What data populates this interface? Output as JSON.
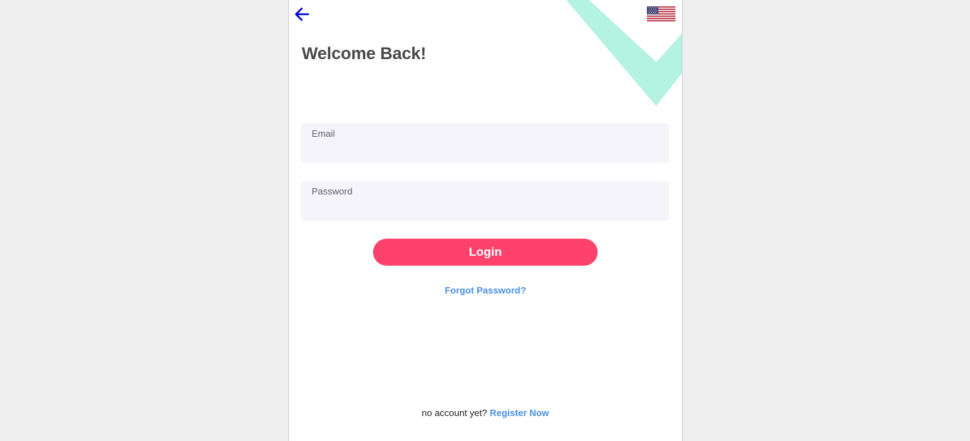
{
  "colors": {
    "page_background": "#eeeeee",
    "panel_background": "#ffffff",
    "accent_decoration": "#b4f2e1",
    "back_arrow": "#0000dd",
    "title_text": "#4a4a4a",
    "field_background": "#f6f4fb",
    "login_button": "#fd436b",
    "link": "#4a90e2"
  },
  "header": {
    "back_icon": "arrow-left-icon",
    "language_icon": "us-flag-icon"
  },
  "title": "Welcome Back!",
  "form": {
    "email": {
      "label": "Email",
      "value": ""
    },
    "password": {
      "label": "Password",
      "value": ""
    },
    "login_label": "Login",
    "forgot_password": "Forgot Password?"
  },
  "footer": {
    "prompt": "no account yet?",
    "register_label": "Register Now"
  }
}
